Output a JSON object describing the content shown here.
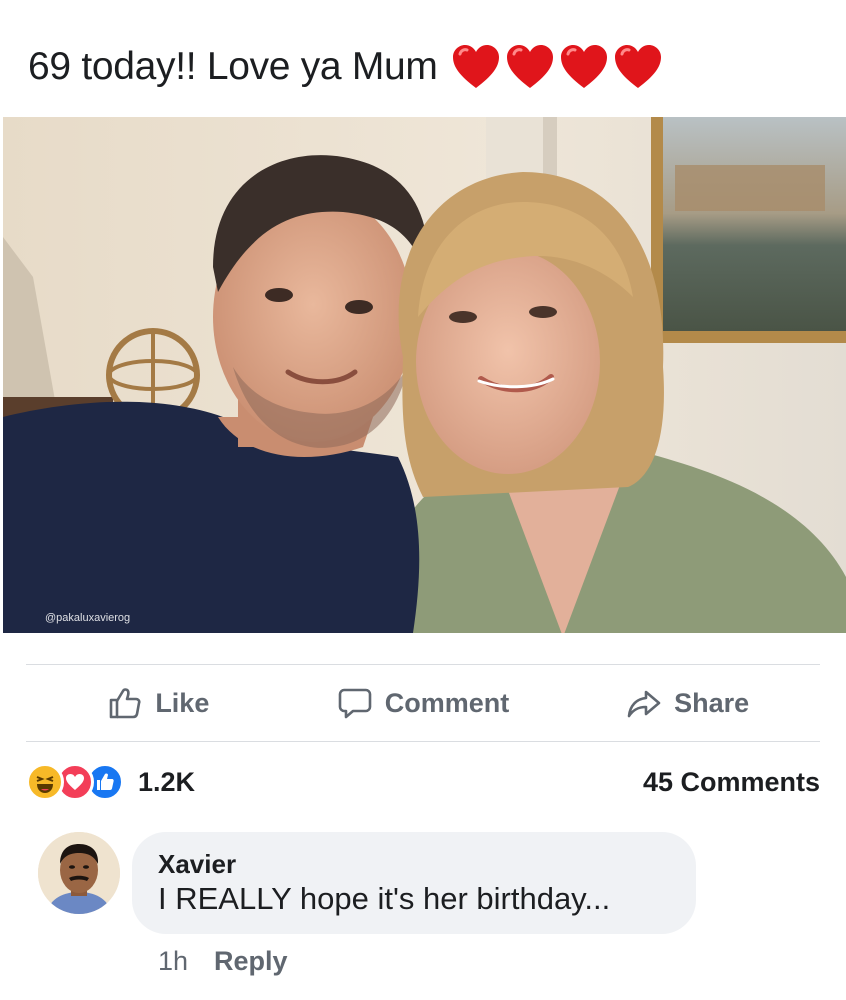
{
  "post": {
    "text": "69 today!! Love ya Mum",
    "hearts": [
      "heart-emoji",
      "heart-emoji",
      "heart-emoji",
      "heart-emoji"
    ],
    "heart_color": "#e0151b"
  },
  "photo": {
    "watermark": "@pakaluxavierog"
  },
  "actions": {
    "like_label": "Like",
    "comment_label": "Comment",
    "share_label": "Share"
  },
  "stats": {
    "reaction_icons": [
      "haha-reaction-icon",
      "love-reaction-icon",
      "like-reaction-icon"
    ],
    "reaction_count": "1.2K",
    "comments_count": "45 Comments"
  },
  "comment": {
    "author": "Xavier",
    "text": "I REALLY hope it's her birthday...",
    "time": "1h",
    "reply_label": "Reply"
  },
  "colors": {
    "text": "#1c1e21",
    "muted": "#606770",
    "divider": "#dadde1",
    "bubble": "#f0f2f5",
    "like_blue": "#1877f2",
    "love_red": "#f33e58",
    "haha_yellow": "#f7b928"
  }
}
